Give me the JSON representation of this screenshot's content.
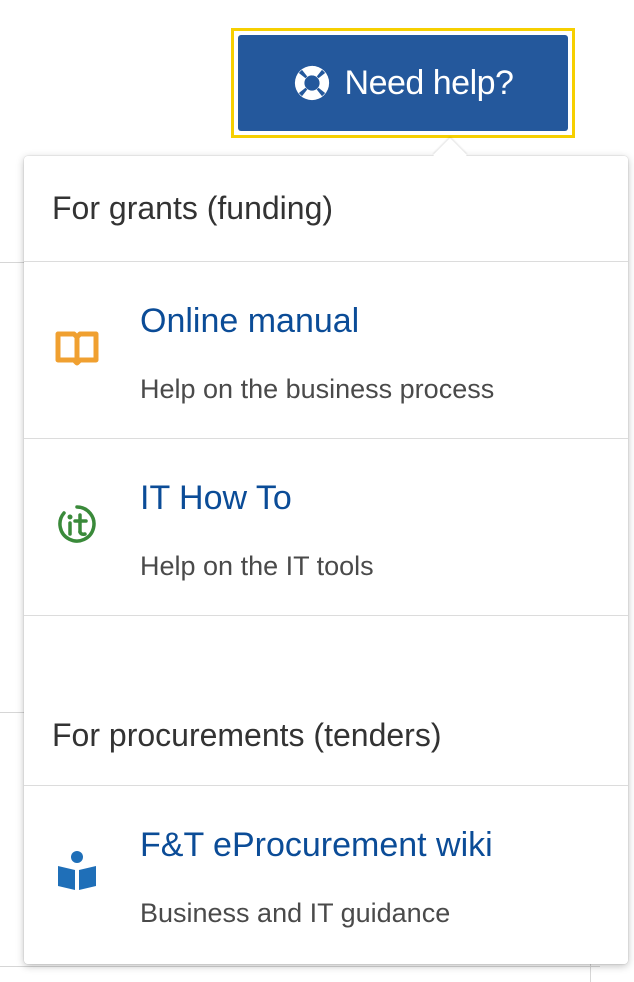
{
  "help_button": {
    "label": "Need help?",
    "icon": "lifebuoy-icon"
  },
  "dropdown": {
    "sections": [
      {
        "header": "For grants (funding)",
        "items": [
          {
            "title": "Online manual",
            "description": "Help on the business process",
            "icon": "book-icon"
          },
          {
            "title": "IT How To",
            "description": "Help on the IT tools",
            "icon": "it-icon"
          }
        ]
      },
      {
        "header": "For procurements (tenders)",
        "items": [
          {
            "title": "F&T eProcurement wiki",
            "description": "Business and IT guidance",
            "icon": "reader-icon"
          }
        ]
      }
    ]
  },
  "colors": {
    "button_bg": "#24589c",
    "button_focus_border": "#f6cf00",
    "link": "#0b4c97",
    "book_icon": "#f0a030",
    "it_icon": "#3a8a3a",
    "reader_icon": "#1f6fb8"
  }
}
